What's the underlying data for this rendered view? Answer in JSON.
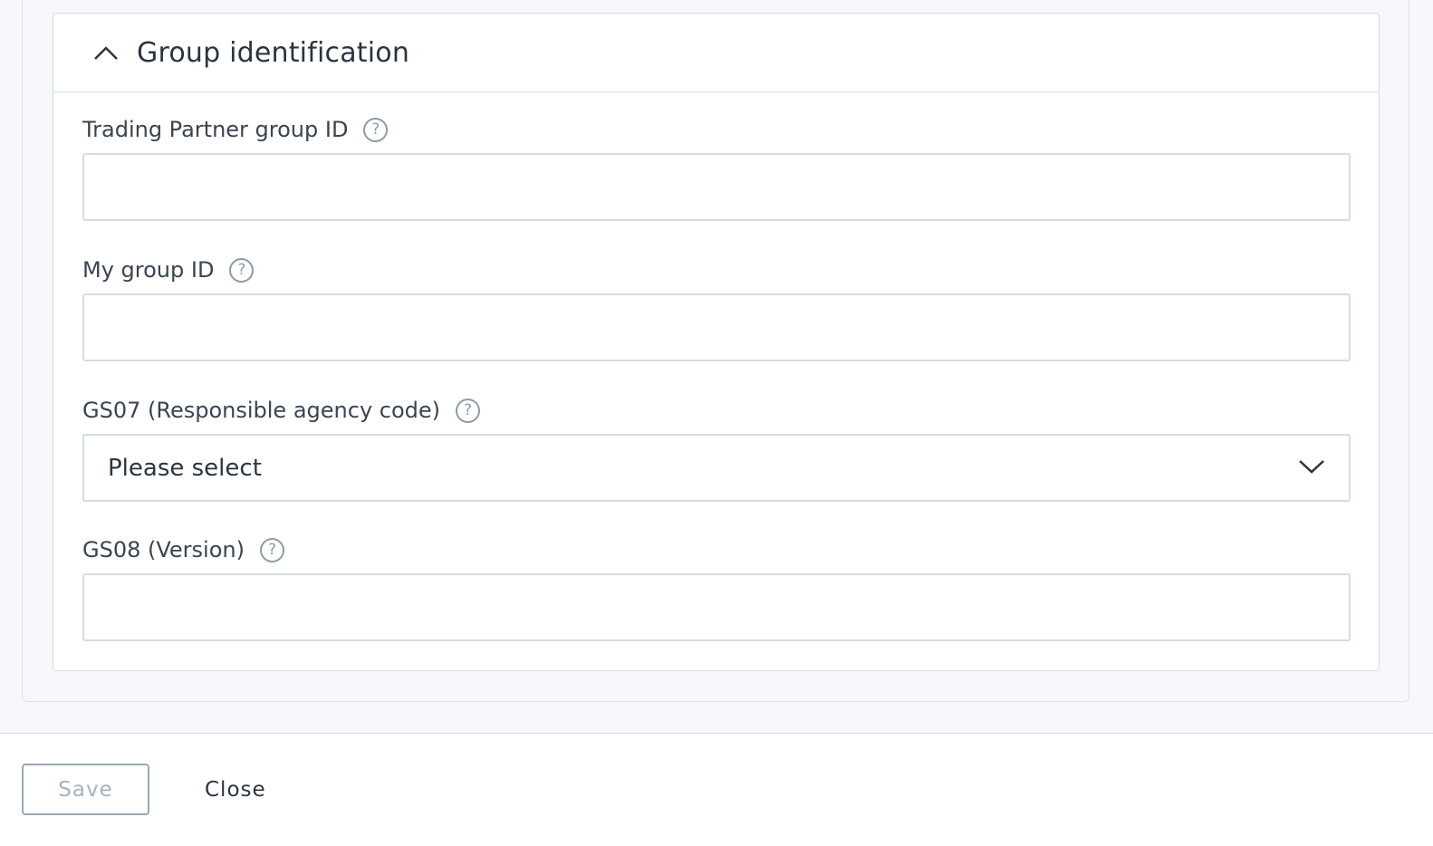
{
  "section": {
    "title": "Group identification",
    "collapse_icon": "chevron-up-icon"
  },
  "fields": {
    "trading_partner_group_id": {
      "label": "Trading Partner group ID",
      "value": "",
      "help_icon": "question-mark-icon"
    },
    "my_group_id": {
      "label": "My group ID",
      "value": "",
      "help_icon": "question-mark-icon"
    },
    "gs07": {
      "label": "GS07 (Responsible agency code)",
      "selected": "Please select",
      "help_icon": "question-mark-icon",
      "dropdown_icon": "chevron-down-icon"
    },
    "gs08": {
      "label": "GS08 (Version)",
      "value": "",
      "help_icon": "question-mark-icon"
    }
  },
  "help_glyph": "?",
  "footer": {
    "save_label": "Save",
    "close_label": "Close"
  }
}
